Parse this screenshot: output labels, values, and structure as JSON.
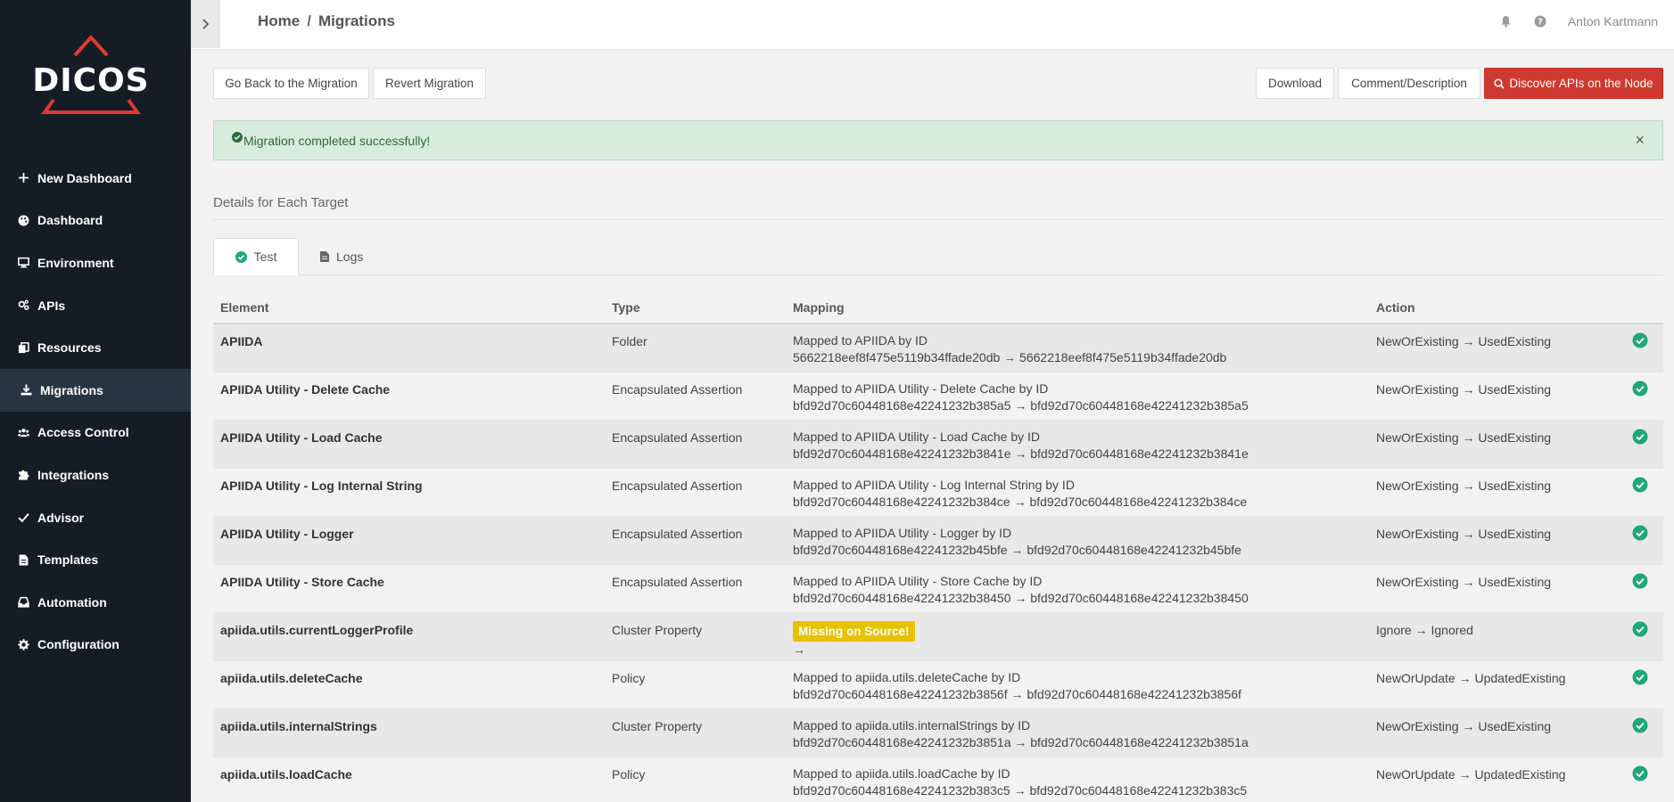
{
  "app": {
    "logo_text": "DICOS"
  },
  "sidebar": {
    "items": [
      {
        "label": "New Dashboard",
        "icon": "plus-icon"
      },
      {
        "label": "Dashboard",
        "icon": "palette-icon"
      },
      {
        "label": "Environment",
        "icon": "monitor-icon"
      },
      {
        "label": "APIs",
        "icon": "cogs-icon"
      },
      {
        "label": "Resources",
        "icon": "copy-icon"
      },
      {
        "label": "Migrations",
        "icon": "download-icon",
        "active": true
      },
      {
        "label": "Access Control",
        "icon": "users-icon"
      },
      {
        "label": "Integrations",
        "icon": "puzzle-icon"
      },
      {
        "label": "Advisor",
        "icon": "check-icon"
      },
      {
        "label": "Templates",
        "icon": "file-icon"
      },
      {
        "label": "Automation",
        "icon": "inbox-icon"
      },
      {
        "label": "Configuration",
        "icon": "gear-icon"
      }
    ]
  },
  "header": {
    "breadcrumb_home": "Home",
    "breadcrumb_sep": "/",
    "breadcrumb_current": "Migrations",
    "user_name": "Anton Kartmann"
  },
  "toolbar": {
    "go_back": "Go Back to the Migration",
    "revert": "Revert Migration",
    "download": "Download",
    "comment": "Comment/Description",
    "discover": "Discover APIs on the Node"
  },
  "alert": {
    "message": "Migration completed successfully!",
    "close": "×"
  },
  "section": {
    "title": "Details for Each Target"
  },
  "tabs": [
    {
      "label": "Test",
      "active": true
    },
    {
      "label": "Logs"
    }
  ],
  "table": {
    "headers": {
      "element": "Element",
      "type": "Type",
      "mapping": "Mapping",
      "action": "Action"
    },
    "rows": [
      {
        "element": "APIIDA",
        "type": "Folder",
        "mapping_line1": "Mapped to APIIDA by ID",
        "mapping_line2": "5662218eef8f475e5119b34ffade20db → 5662218eef8f475e5119b34ffade20db",
        "action": "NewOrExisting → UsedExisting"
      },
      {
        "element": "APIIDA Utility - Delete Cache",
        "type": "Encapsulated Assertion",
        "mapping_line1": "Mapped to APIIDA Utility - Delete Cache by ID",
        "mapping_line2": "bfd92d70c60448168e42241232b385a5 → bfd92d70c60448168e42241232b385a5",
        "action": "NewOrExisting → UsedExisting"
      },
      {
        "element": "APIIDA Utility - Load Cache",
        "type": "Encapsulated Assertion",
        "mapping_line1": "Mapped to APIIDA Utility - Load Cache by ID",
        "mapping_line2": "bfd92d70c60448168e42241232b3841e → bfd92d70c60448168e42241232b3841e",
        "action": "NewOrExisting → UsedExisting"
      },
      {
        "element": "APIIDA Utility - Log Internal String",
        "type": "Encapsulated Assertion",
        "mapping_line1": "Mapped to APIIDA Utility - Log Internal String by ID",
        "mapping_line2": "bfd92d70c60448168e42241232b384ce → bfd92d70c60448168e42241232b384ce",
        "action": "NewOrExisting → UsedExisting"
      },
      {
        "element": "APIIDA Utility - Logger",
        "type": "Encapsulated Assertion",
        "mapping_line1": "Mapped to APIIDA Utility - Logger by ID",
        "mapping_line2": "bfd92d70c60448168e42241232b45bfe → bfd92d70c60448168e42241232b45bfe",
        "action": "NewOrExisting → UsedExisting"
      },
      {
        "element": "APIIDA Utility - Store Cache",
        "type": "Encapsulated Assertion",
        "mapping_line1": "Mapped to APIIDA Utility - Store Cache by ID",
        "mapping_line2": "bfd92d70c60448168e42241232b38450 → bfd92d70c60448168e42241232b38450",
        "action": "NewOrExisting → UsedExisting"
      },
      {
        "element": "apiida.utils.currentLoggerProfile",
        "type": "Cluster Property",
        "badge": "Missing on Source!",
        "mapping_line2": "→",
        "action": "Ignore → Ignored"
      },
      {
        "element": "apiida.utils.deleteCache",
        "type": "Policy",
        "mapping_line1": "Mapped to apiida.utils.deleteCache by ID",
        "mapping_line2": "bfd92d70c60448168e42241232b3856f → bfd92d70c60448168e42241232b3856f",
        "action": "NewOrUpdate → UpdatedExisting"
      },
      {
        "element": "apiida.utils.internalStrings",
        "type": "Cluster Property",
        "mapping_line1": "Mapped to apiida.utils.internalStrings by ID",
        "mapping_line2": "bfd92d70c60448168e42241232b3851a → bfd92d70c60448168e42241232b3851a",
        "action": "NewOrExisting → UsedExisting"
      },
      {
        "element": "apiida.utils.loadCache",
        "type": "Policy",
        "mapping_line1": "Mapped to apiida.utils.loadCache by ID",
        "mapping_line2": "bfd92d70c60448168e42241232b383c5 → bfd92d70c60448168e42241232b383c5",
        "action": "NewOrUpdate → UpdatedExisting"
      }
    ]
  },
  "colors": {
    "sidebar_bg": "#141d26",
    "active_bg": "#273543",
    "primary_red": "#d0392f",
    "success_green": "#1fa67a",
    "badge_yellow": "#e6c200"
  }
}
